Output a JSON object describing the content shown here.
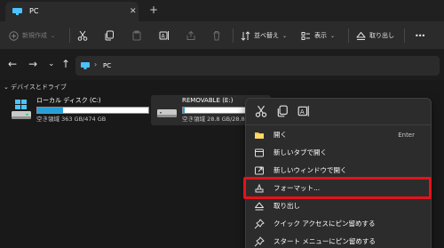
{
  "tabstrip": {
    "tab_title": "PC",
    "close_glyph": "✕",
    "new_tab_glyph": "+",
    "accent": "#4cc2ff"
  },
  "commandbar": {
    "new_label": "新規作成",
    "sort_label": "並べ替え",
    "view_label": "表示",
    "eject_label": "取り出し",
    "more_glyph": "•••",
    "chevron_glyph": "⌄"
  },
  "navigation": {
    "back_glyph": "←",
    "forward_glyph": "→",
    "recent_glyph": "⌄",
    "up_glyph": "↑",
    "address_separator": "›",
    "address_text": "PC"
  },
  "content": {
    "section_header": "⌄ デバイスとドライブ",
    "drives": [
      {
        "name": "ローカル ディスク (C:)",
        "space": "空き領域 363 GB/474 GB",
        "used_fraction": 0.23
      },
      {
        "name": "REMOVABLE (E:)",
        "space": "空き領域 28.8 GB/28.8",
        "used_fraction": 0.02
      }
    ]
  },
  "context_menu": {
    "toolbar_icons": [
      "cut-icon",
      "copy-icon",
      "rename-icon"
    ],
    "items": [
      {
        "label": "開く",
        "shortcut": "Enter",
        "icon": "folder-icon"
      },
      {
        "label": "新しいタブで開く",
        "icon": "new-tab-icon"
      },
      {
        "label": "新しいウィンドウで開く",
        "icon": "new-window-icon"
      },
      {
        "label": "フォーマット...",
        "icon": "format-drive-icon"
      },
      {
        "label": "取り出し",
        "icon": "eject-icon"
      },
      {
        "label": "クイック アクセスにピン留めする",
        "icon": "pin-icon"
      },
      {
        "label": "スタート メニューにピン留めする",
        "icon": "pin-icon"
      }
    ]
  },
  "colors": {
    "highlight": "#e5121a",
    "drive_bar": "#26a0da"
  }
}
